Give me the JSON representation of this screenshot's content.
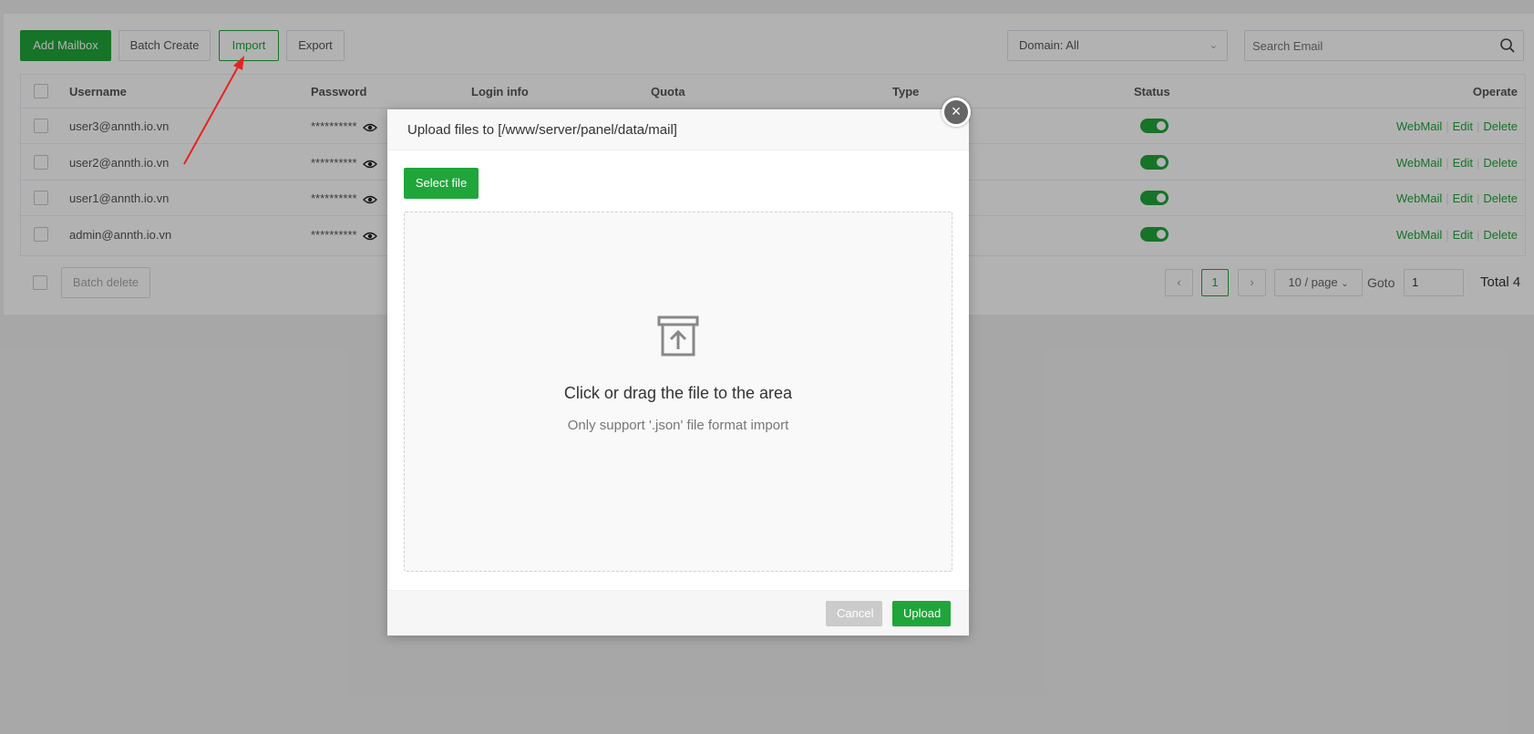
{
  "toolbar": {
    "add_mailbox": "Add Mailbox",
    "batch_create": "Batch Create",
    "import": "Import",
    "export": "Export",
    "domain_filter": "Domain: All",
    "search_placeholder": "Search Email"
  },
  "table": {
    "headers": [
      "Username",
      "Password",
      "Login info",
      "Quota",
      "Type",
      "Status",
      "Operate"
    ],
    "rows": [
      {
        "username": "user3@annth.io.vn",
        "password": "**********"
      },
      {
        "username": "user2@annth.io.vn",
        "password": "**********"
      },
      {
        "username": "user1@annth.io.vn",
        "password": "**********"
      },
      {
        "username": "admin@annth.io.vn",
        "password": "**********"
      }
    ],
    "ops": {
      "webmail": "WebMail",
      "edit": "Edit",
      "delete": "Delete"
    }
  },
  "footer": {
    "batch_delete": "Batch delete",
    "current_page": "1",
    "page_size": "10 / page",
    "goto_label": "Goto",
    "goto_value": "1",
    "total": "Total 4"
  },
  "dialog": {
    "title": "Upload files to [/www/server/panel/data/mail]",
    "close": "×",
    "select_file": "Select file",
    "drop_main": "Click or drag the file to the area",
    "drop_sub": "Only support '.json' file format import",
    "cancel": "Cancel",
    "upload": "Upload"
  },
  "colors": {
    "accent": "#20a53a",
    "annotation_arrow": "#e8231f"
  }
}
